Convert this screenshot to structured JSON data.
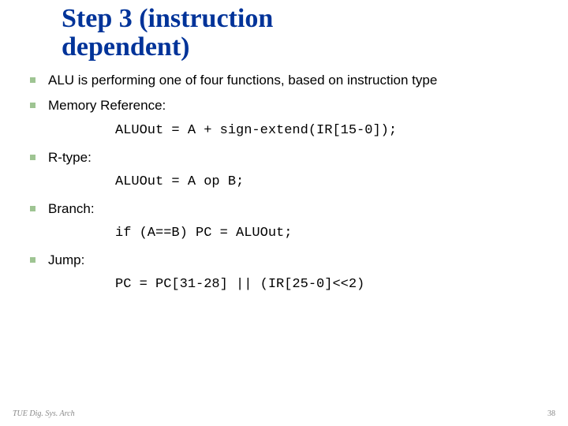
{
  "title_line1": "Step 3 (instruction",
  "title_line2": "dependent)",
  "bullets": [
    {
      "label": "ALU is performing one of four functions, based on instruction type",
      "code": null
    },
    {
      "label": "Memory Reference:",
      "code": "ALUOut = A + sign-extend(IR[15-0]);"
    },
    {
      "label": "R-type:",
      "code": "ALUOut = A op B;"
    },
    {
      "label": "Branch:",
      "code": "if (A==B) PC = ALUOut;"
    },
    {
      "label": "Jump:",
      "code": "PC = PC[31-28] || (IR[25-0]<<2)"
    }
  ],
  "footer_left": "TUE Dig. Sys. Arch",
  "footer_right": "38"
}
